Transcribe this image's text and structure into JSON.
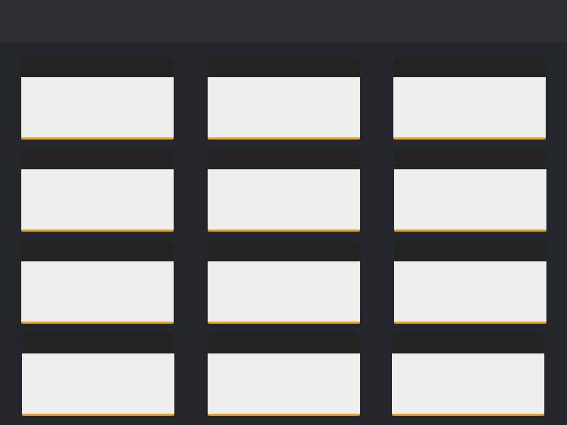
{
  "top_bar": {
    "background": "#2c3035"
  },
  "content": {
    "background": "#23272b"
  },
  "card_style": {
    "header_color": "#232323",
    "body_color": "#eeeeee",
    "accent_color": "#e5a021"
  },
  "cards": [
    {
      "title": ""
    },
    {
      "title": ""
    },
    {
      "title": ""
    },
    {
      "title": ""
    },
    {
      "title": ""
    },
    {
      "title": ""
    },
    {
      "title": ""
    },
    {
      "title": ""
    },
    {
      "title": ""
    },
    {
      "title": ""
    },
    {
      "title": ""
    },
    {
      "title": ""
    }
  ]
}
